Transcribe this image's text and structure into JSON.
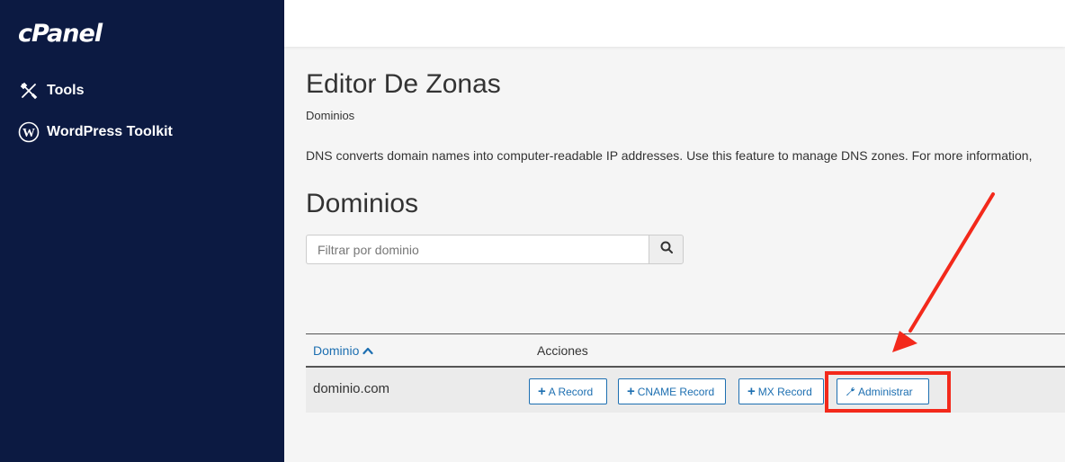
{
  "sidebar": {
    "logo": "cPanel",
    "items": [
      {
        "label": "Tools",
        "icon": "tools-icon"
      },
      {
        "label": "WordPress Toolkit",
        "icon": "wordpress-icon"
      }
    ]
  },
  "page": {
    "title": "Editor De Zonas",
    "breadcrumb": "Dominios",
    "description": "DNS converts domain names into computer-readable IP addresses. Use this feature to manage DNS zones. For more information,",
    "section_title": "Dominios"
  },
  "search": {
    "placeholder": "Filtrar por dominio",
    "icon": "search-icon"
  },
  "table": {
    "headers": {
      "domain": "Dominio",
      "actions": "Acciones"
    },
    "sort_direction": "ascending",
    "rows": [
      {
        "domain": "dominio.com",
        "actions": [
          "A Record",
          "CNAME Record",
          "MX Record",
          "Administrar"
        ]
      }
    ]
  },
  "annotation": {
    "color": "#f3291b",
    "target": "Administrar"
  },
  "colors": {
    "sidebar": "#0c1a42",
    "accent": "#1d6fb1"
  }
}
